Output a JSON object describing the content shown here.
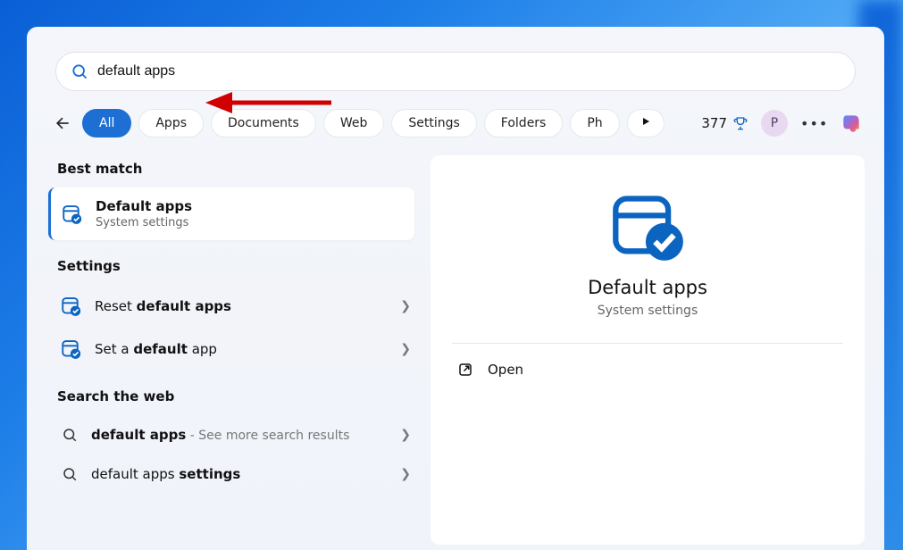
{
  "search": {
    "query": "default apps"
  },
  "filters": {
    "items": [
      "All",
      "Apps",
      "Documents",
      "Web",
      "Settings",
      "Folders",
      "Ph"
    ],
    "active_index": 0
  },
  "toolbar": {
    "points": "377",
    "avatar_initial": "P"
  },
  "sections": {
    "best_match_header": "Best match",
    "settings_header": "Settings",
    "web_header": "Search the web"
  },
  "best_match": {
    "title": "Default apps",
    "subtitle": "System settings"
  },
  "settings_results": [
    {
      "prefix": "Reset ",
      "bold": "default apps",
      "suffix": ""
    },
    {
      "prefix": "Set a ",
      "bold": "default",
      "suffix": " app"
    }
  ],
  "web_results": [
    {
      "prefix": "",
      "bold": "default apps",
      "suffix": "",
      "trailing": " - See more search results"
    },
    {
      "prefix": "default apps ",
      "bold": "settings",
      "suffix": "",
      "trailing": ""
    }
  ],
  "preview": {
    "title": "Default apps",
    "subtitle": "System settings",
    "open_label": "Open"
  }
}
